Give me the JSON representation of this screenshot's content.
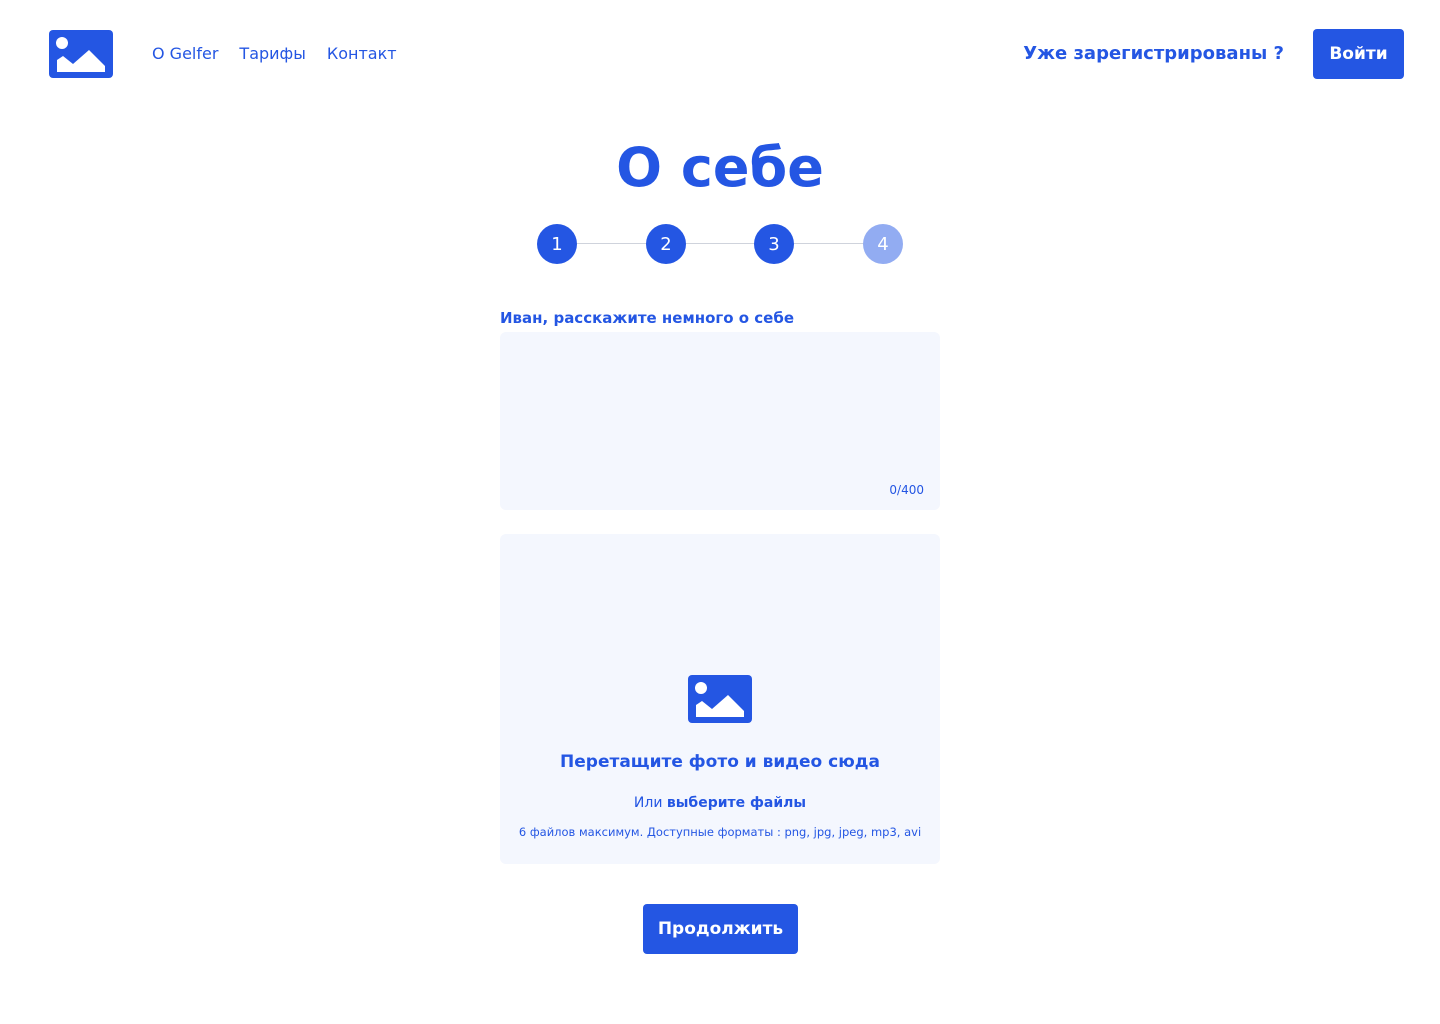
{
  "colors": {
    "accent": "#2456e3",
    "step_pending": "#92acf2",
    "field_bg": "#f4f7fe"
  },
  "header": {
    "logo_icon": "image-icon",
    "nav": [
      {
        "label": "О Gelfer"
      },
      {
        "label": "Тарифы"
      },
      {
        "label": "Контакт"
      }
    ],
    "already_registered": "Уже зарегистрированы ?",
    "login_label": "Войти"
  },
  "page": {
    "title": "О себе"
  },
  "stepper": {
    "current": 4,
    "steps": [
      {
        "label": "1",
        "state": "done"
      },
      {
        "label": "2",
        "state": "done"
      },
      {
        "label": "3",
        "state": "done"
      },
      {
        "label": "4",
        "state": "pending"
      }
    ]
  },
  "about": {
    "label": "Иван, расскажите немного о себе",
    "value": "",
    "counter": "0/400"
  },
  "upload": {
    "icon": "image-icon",
    "title": "Перетащите фото и видео сюда",
    "or_text": "Или",
    "pick_link": "выберите файлы",
    "hint": "6 файлов максимум. Доступные форматы : png, jpg, jpeg, mp3, avi"
  },
  "footer": {
    "continue_label": "Продолжить"
  }
}
